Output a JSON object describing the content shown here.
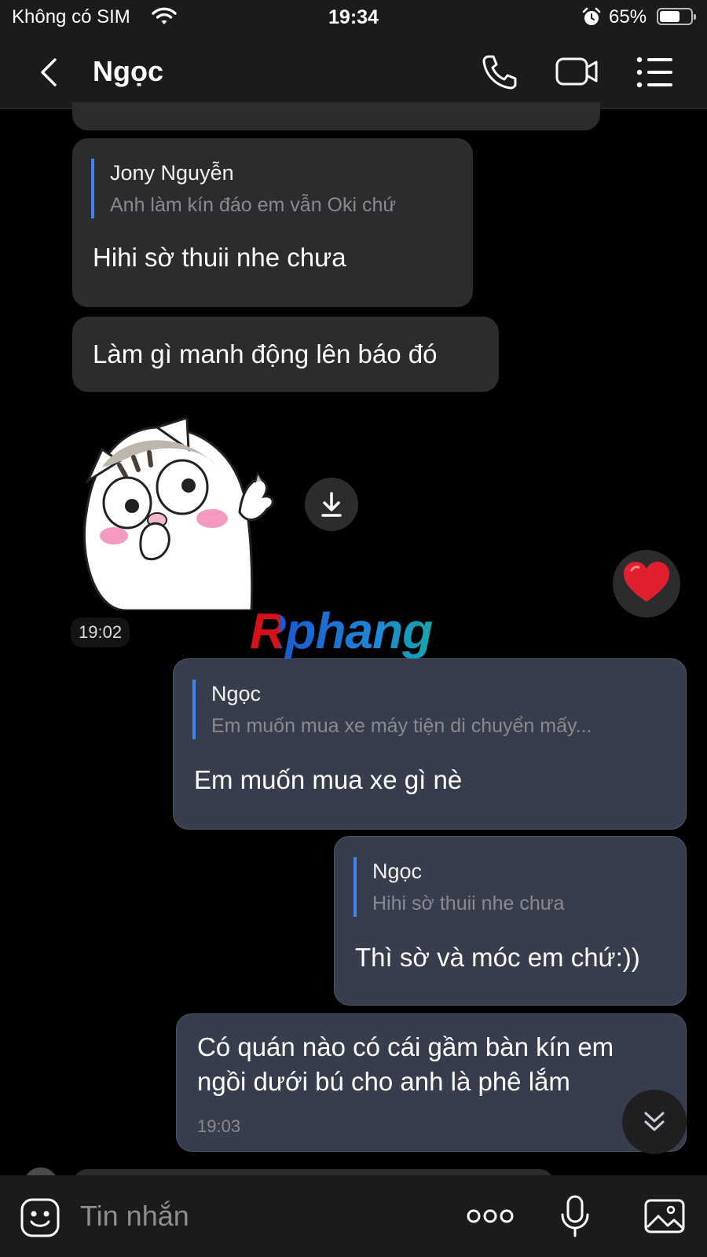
{
  "status_bar": {
    "carrier": "Không có SIM",
    "time": "19:34",
    "battery_percent": "65%",
    "battery_level": 0.65
  },
  "header": {
    "title": "Ngọc"
  },
  "messages": [
    {
      "direction": "incoming",
      "reply_to": {
        "name": "Jony Nguyễn",
        "text": "Anh làm kín đáo em vẫn Oki chứ"
      },
      "text": "Hihi sờ thuii nhe chưa"
    },
    {
      "direction": "incoming",
      "text": "Làm gì manh động lên báo đó"
    },
    {
      "direction": "incoming",
      "type": "sticker",
      "sticker": "cat-pleading-sticker",
      "time": "19:02",
      "reaction": "heart"
    },
    {
      "direction": "outgoing",
      "reply_to": {
        "name": "Ngọc",
        "text": "Em muốn mua xe máy tiện di chuyển mấy..."
      },
      "text": "Em muốn mua xe gì nè"
    },
    {
      "direction": "outgoing",
      "reply_to": {
        "name": "Ngọc",
        "text": "Hihi sờ thuii nhe chưa"
      },
      "text": "Thì sờ và móc em chứ:))"
    },
    {
      "direction": "outgoing",
      "text_lines": [
        "Có quán nào có cái gầm bàn kín em",
        "ngồi dưới bú cho anh là phê lắm"
      ],
      "time": "19:03"
    }
  ],
  "watermark": "Rphang",
  "composer": {
    "placeholder": "Tin nhắn"
  },
  "icons": {
    "back": "chevron-left-icon",
    "call": "phone-icon",
    "video": "video-camera-icon",
    "menu": "list-menu-icon",
    "download": "download-icon",
    "reaction": "heart-icon",
    "scroll": "double-chevron-down-icon",
    "emoji": "emoji-icon",
    "more": "more-dots-icon",
    "mic": "microphone-icon",
    "gallery": "image-gallery-icon"
  },
  "colors": {
    "background": "#000000",
    "bar": "#1b1b1c",
    "incoming_bubble": "#2c2c2e",
    "outgoing_bubble": "#373d4c",
    "quote_accent": "#3f82f0",
    "heart": "#e0202e"
  }
}
